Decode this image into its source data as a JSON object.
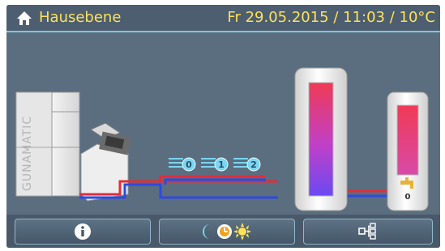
{
  "header": {
    "title": "Hausebene",
    "datetime": "Fr 29.05.2015 / 11:03 /  10°C",
    "home_icon": "home-icon"
  },
  "scene": {
    "boiler_brand": "GUNAMATIC",
    "heating_circuits": [
      {
        "label": "0"
      },
      {
        "label": "1"
      },
      {
        "label": "2"
      }
    ],
    "hot_water_label": "0"
  },
  "toolbar": {
    "buttons": [
      {
        "icon": "info-icon"
      },
      {
        "icon": "time-program-icon"
      },
      {
        "icon": "hydraulic-scheme-icon"
      }
    ]
  },
  "colors": {
    "accent_text": "#ffe15a",
    "supply_pipe": "#e02e3a",
    "return_pipe": "#2e4ae0",
    "background": "#5b6e80"
  }
}
